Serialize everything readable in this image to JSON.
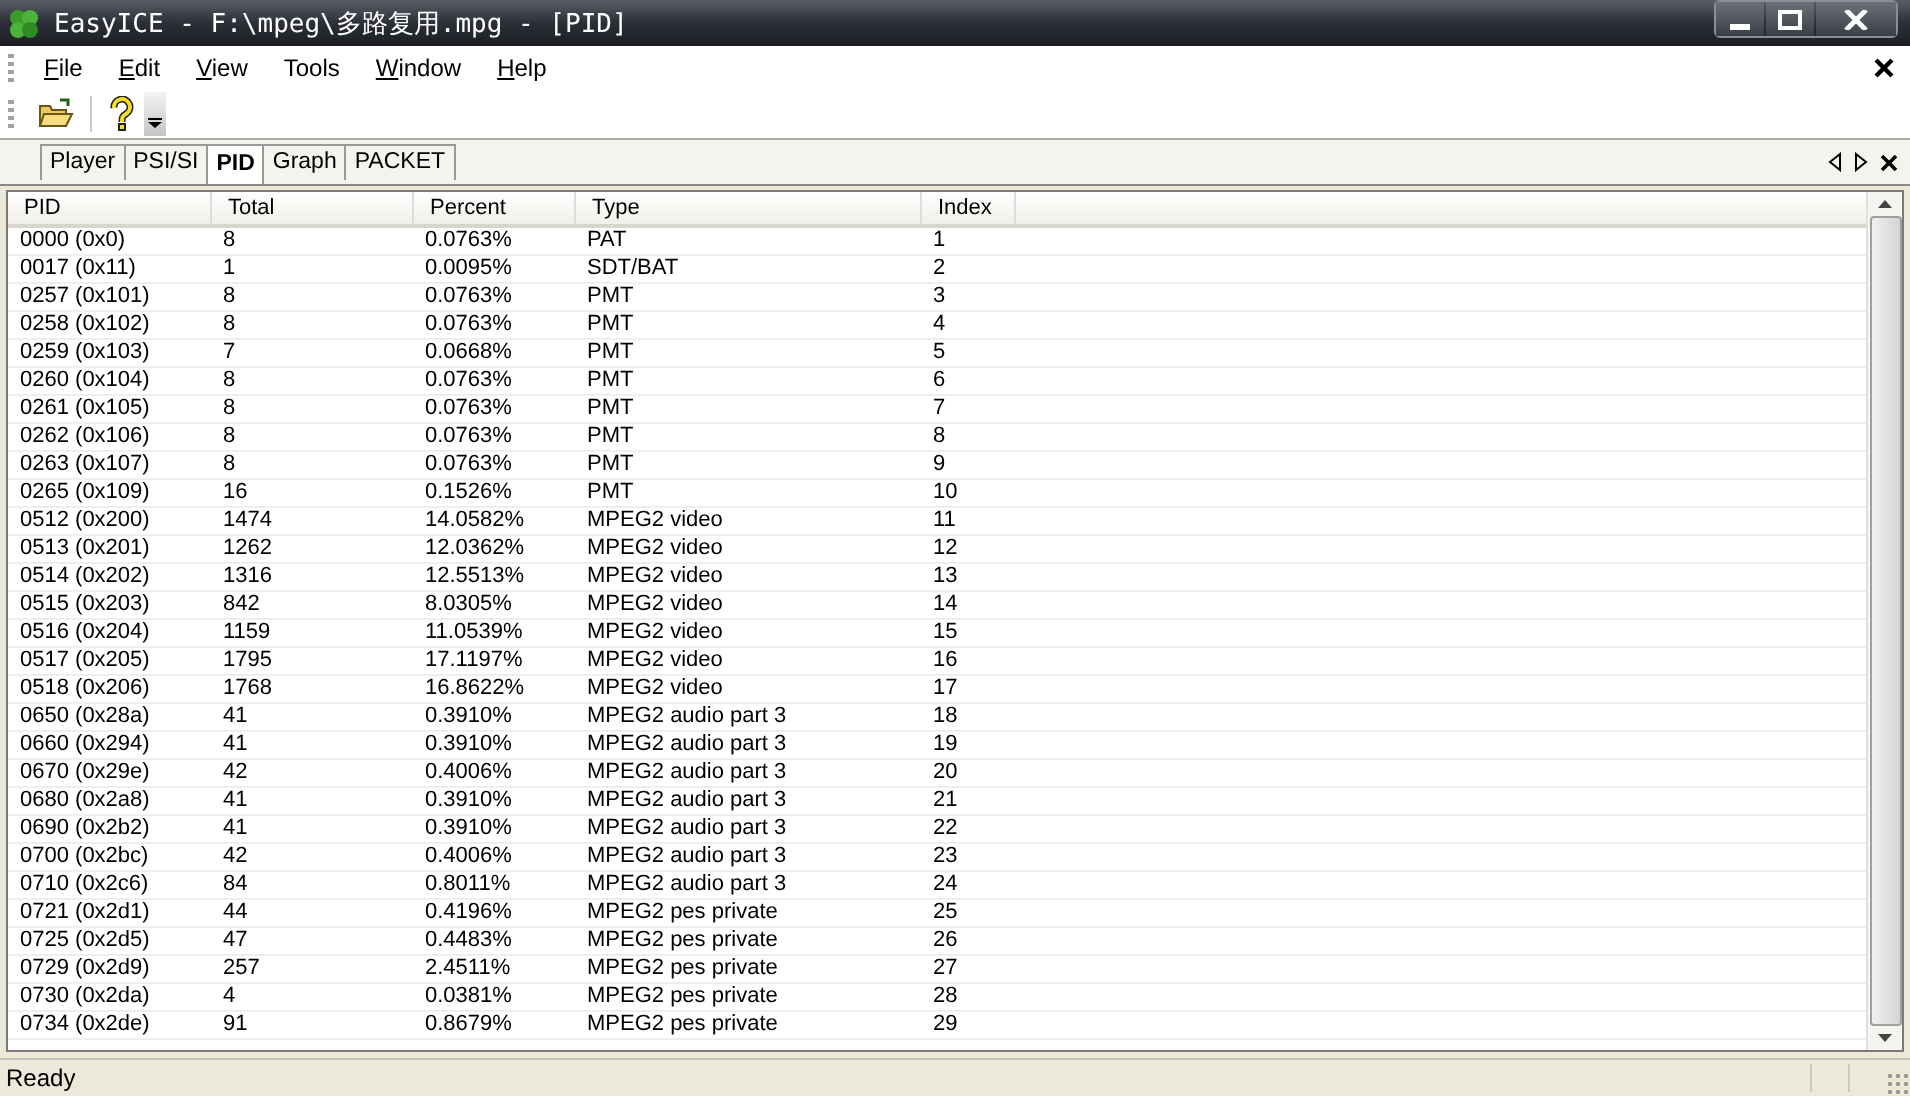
{
  "window": {
    "title": "EasyICE - F:\\mpeg\\多路复用.mpg - [PID]"
  },
  "menu": [
    {
      "label": "File",
      "accel": true
    },
    {
      "label": "Edit",
      "accel": true
    },
    {
      "label": "View",
      "accel": true
    },
    {
      "label": "Tools",
      "accel": false
    },
    {
      "label": "Window",
      "accel": true
    },
    {
      "label": "Help",
      "accel": true
    }
  ],
  "tabs": [
    {
      "label": "Player",
      "selected": false
    },
    {
      "label": "PSI/SI",
      "selected": false
    },
    {
      "label": "PID",
      "selected": true
    },
    {
      "label": "Graph",
      "selected": false
    },
    {
      "label": "PACKET",
      "selected": false
    }
  ],
  "table": {
    "columns": [
      "PID",
      "Total",
      "Percent",
      "Type",
      "Index"
    ],
    "rows": [
      [
        "0000 (0x0)",
        "8",
        "0.0763%",
        "PAT",
        "1"
      ],
      [
        "0017 (0x11)",
        "1",
        "0.0095%",
        "SDT/BAT",
        "2"
      ],
      [
        "0257 (0x101)",
        "8",
        "0.0763%",
        "PMT",
        "3"
      ],
      [
        "0258 (0x102)",
        "8",
        "0.0763%",
        "PMT",
        "4"
      ],
      [
        "0259 (0x103)",
        "7",
        "0.0668%",
        "PMT",
        "5"
      ],
      [
        "0260 (0x104)",
        "8",
        "0.0763%",
        "PMT",
        "6"
      ],
      [
        "0261 (0x105)",
        "8",
        "0.0763%",
        "PMT",
        "7"
      ],
      [
        "0262 (0x106)",
        "8",
        "0.0763%",
        "PMT",
        "8"
      ],
      [
        "0263 (0x107)",
        "8",
        "0.0763%",
        "PMT",
        "9"
      ],
      [
        "0265 (0x109)",
        "16",
        "0.1526%",
        "PMT",
        "10"
      ],
      [
        "0512 (0x200)",
        "1474",
        "14.0582%",
        "MPEG2 video",
        "11"
      ],
      [
        "0513 (0x201)",
        "1262",
        "12.0362%",
        "MPEG2 video",
        "12"
      ],
      [
        "0514 (0x202)",
        "1316",
        "12.5513%",
        "MPEG2 video",
        "13"
      ],
      [
        "0515 (0x203)",
        "842",
        "8.0305%",
        "MPEG2 video",
        "14"
      ],
      [
        "0516 (0x204)",
        "1159",
        "11.0539%",
        "MPEG2 video",
        "15"
      ],
      [
        "0517 (0x205)",
        "1795",
        "17.1197%",
        "MPEG2 video",
        "16"
      ],
      [
        "0518 (0x206)",
        "1768",
        "16.8622%",
        "MPEG2 video",
        "17"
      ],
      [
        "0650 (0x28a)",
        "41",
        "0.3910%",
        "MPEG2 audio part 3",
        "18"
      ],
      [
        "0660 (0x294)",
        "41",
        "0.3910%",
        "MPEG2 audio part 3",
        "19"
      ],
      [
        "0670 (0x29e)",
        "42",
        "0.4006%",
        "MPEG2 audio part 3",
        "20"
      ],
      [
        "0680 (0x2a8)",
        "41",
        "0.3910%",
        "MPEG2 audio part 3",
        "21"
      ],
      [
        "0690 (0x2b2)",
        "41",
        "0.3910%",
        "MPEG2 audio part 3",
        "22"
      ],
      [
        "0700 (0x2bc)",
        "42",
        "0.4006%",
        "MPEG2 audio part 3",
        "23"
      ],
      [
        "0710 (0x2c6)",
        "84",
        "0.8011%",
        "MPEG2 audio part 3",
        "24"
      ],
      [
        "0721 (0x2d1)",
        "44",
        "0.4196%",
        "MPEG2 pes private",
        "25"
      ],
      [
        "0725 (0x2d5)",
        "47",
        "0.4483%",
        "MPEG2 pes private",
        "26"
      ],
      [
        "0729 (0x2d9)",
        "257",
        "2.4511%",
        "MPEG2 pes private",
        "27"
      ],
      [
        "0730 (0x2da)",
        "4",
        "0.0381%",
        "MPEG2 pes private",
        "28"
      ],
      [
        "0734 (0x2de)",
        "91",
        "0.8679%",
        "MPEG2 pes private",
        "29"
      ]
    ]
  },
  "status_bar": {
    "text": "Ready"
  }
}
